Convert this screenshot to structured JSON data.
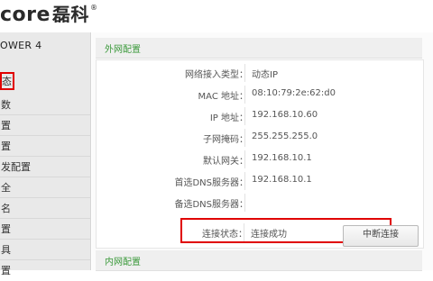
{
  "brand": {
    "name": "core",
    "cn": "磊科",
    "reg": "®"
  },
  "sidebar": {
    "model": "OWER 4",
    "items": [
      {
        "label": "态"
      },
      {
        "label": "数"
      },
      {
        "label": "置"
      },
      {
        "label": "置"
      },
      {
        "label": "发配置"
      },
      {
        "label": "全"
      },
      {
        "label": "名"
      },
      {
        "label": "置"
      },
      {
        "label": "具"
      },
      {
        "label": "置"
      }
    ]
  },
  "wan": {
    "title": "外网配置",
    "rows": [
      {
        "label": "网络接入类型：",
        "value": "动态IP"
      },
      {
        "label": "MAC 地址：",
        "value": "08:10:79:2e:62:d0"
      },
      {
        "label": "IP 地址：",
        "value": "192.168.10.60"
      },
      {
        "label": "子网掩码：",
        "value": "255.255.255.0"
      },
      {
        "label": "默认网关：",
        "value": "192.168.10.1"
      },
      {
        "label": "首选DNS服务器：",
        "value": "192.168.10.1"
      },
      {
        "label": "备选DNS服务器：",
        "value": ""
      }
    ],
    "status": {
      "label": "连接状态：",
      "value": "连接成功"
    },
    "disconnect_label": "中断连接"
  },
  "lan": {
    "title": "内网配置"
  },
  "colors": {
    "highlight": "#e00000",
    "section_title": "#3c9a3c"
  }
}
